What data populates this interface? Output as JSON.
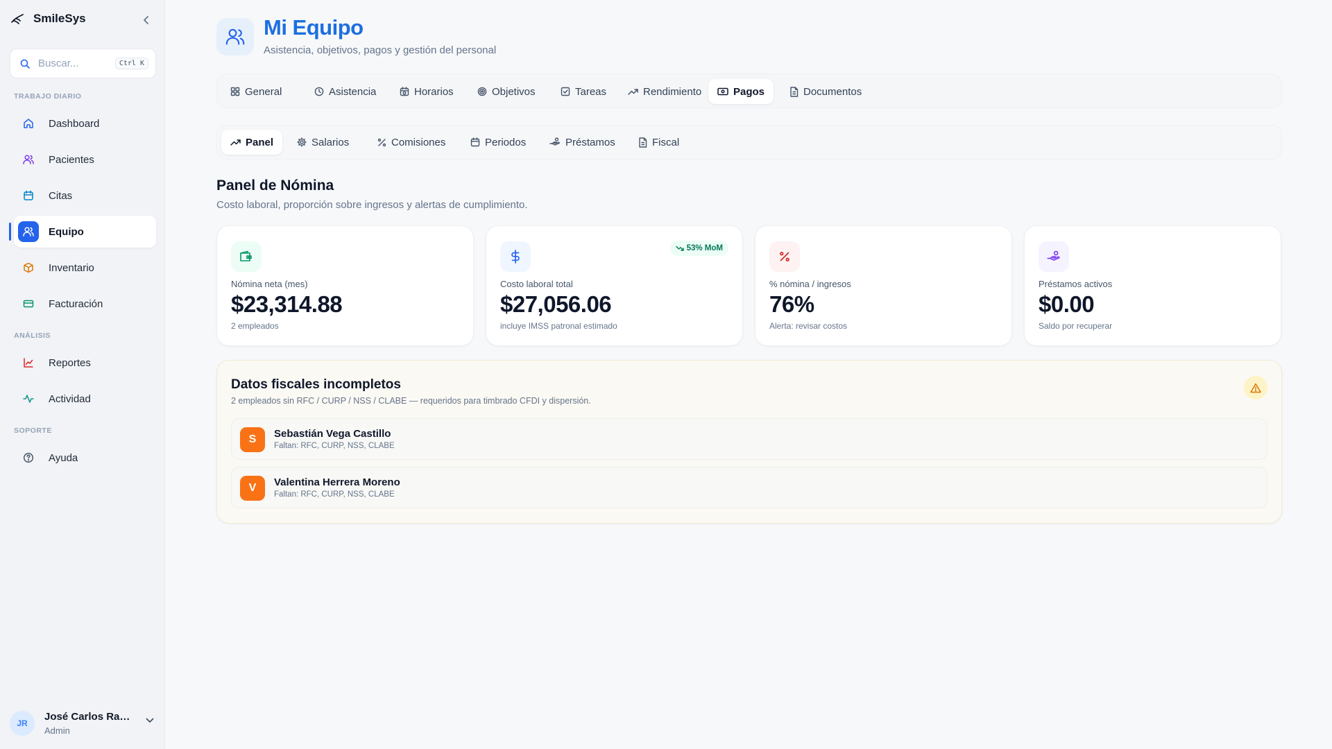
{
  "app": {
    "name": "SmileSys"
  },
  "search": {
    "placeholder": "Buscar...",
    "shortcut": "Ctrl K"
  },
  "sidebar": {
    "sections": [
      {
        "label": "TRABAJO DIARIO"
      },
      {
        "label": "ANÁLISIS"
      },
      {
        "label": "SOPORTE"
      }
    ],
    "items": [
      {
        "label": "Dashboard",
        "icon": "home-icon",
        "color": "#2563eb"
      },
      {
        "label": "Pacientes",
        "icon": "users-icon",
        "color": "#7c3aed"
      },
      {
        "label": "Citas",
        "icon": "calendar-icon",
        "color": "#0284c7"
      },
      {
        "label": "Equipo",
        "icon": "team-icon",
        "color": "#ffffff",
        "active": true
      },
      {
        "label": "Inventario",
        "icon": "box-icon",
        "color": "#d97706"
      },
      {
        "label": "Facturación",
        "icon": "credit-card-icon",
        "color": "#059669"
      },
      {
        "label": "Reportes",
        "icon": "chart-line-icon",
        "color": "#dc2626"
      },
      {
        "label": "Actividad",
        "icon": "activity-icon",
        "color": "#0d9488"
      },
      {
        "label": "Ayuda",
        "icon": "help-circle-icon",
        "color": "#475569"
      }
    ]
  },
  "user": {
    "initials": "JR",
    "name": "José Carlos Ramírez",
    "role": "Admin"
  },
  "header": {
    "title": "Mi Equipo",
    "subtitle": "Asistencia, objetivos, pagos y gestión del personal"
  },
  "tabs": [
    {
      "label": "General",
      "icon": "grid-icon"
    },
    {
      "label": "Asistencia",
      "icon": "clock-icon"
    },
    {
      "label": "Horarios",
      "icon": "calendar-clock-icon"
    },
    {
      "label": "Objetivos",
      "icon": "target-icon"
    },
    {
      "label": "Tareas",
      "icon": "check-square-icon"
    },
    {
      "label": "Rendimiento",
      "icon": "trending-up-icon"
    },
    {
      "label": "Pagos",
      "icon": "banknote-icon",
      "active": true
    },
    {
      "label": "Documentos",
      "icon": "file-icon"
    }
  ],
  "subtabs": [
    {
      "label": "Panel",
      "icon": "trending-up-icon",
      "active": true
    },
    {
      "label": "Salarios",
      "icon": "gear-icon"
    },
    {
      "label": "Comisiones",
      "icon": "percent-icon"
    },
    {
      "label": "Periodos",
      "icon": "calendar-icon"
    },
    {
      "label": "Préstamos",
      "icon": "hand-coins-icon"
    },
    {
      "label": "Fiscal",
      "icon": "file-text-icon"
    }
  ],
  "panel": {
    "title": "Panel de Nómina",
    "description": "Costo laboral, proporción sobre ingresos y alertas de cumplimiento."
  },
  "kpis": [
    {
      "label": "Nómina neta (mes)",
      "value": "$23,314.88",
      "caption": "2 empleados",
      "icon": "wallet-icon",
      "color": "#059669",
      "bg": "#ecfdf5"
    },
    {
      "label": "Costo laboral total",
      "value": "$27,056.06",
      "caption": "incluye IMSS patronal estimado",
      "icon": "dollar-icon",
      "color": "#2563eb",
      "bg": "#eff6ff",
      "badge": "53% MoM"
    },
    {
      "label": "% nómina / ingresos",
      "value": "76%",
      "caption": "Alerta: revisar costos",
      "icon": "percent-icon",
      "color": "#dc2626",
      "bg": "#fef2f2"
    },
    {
      "label": "Préstamos activos",
      "value": "$0.00",
      "caption": "Saldo por recuperar",
      "icon": "hand-coins-icon",
      "color": "#7c3aed",
      "bg": "#f5f3ff"
    }
  ],
  "alert": {
    "title": "Datos fiscales incompletos",
    "description": "2 empleados sin RFC / CURP / NSS / CLABE — requeridos para timbrado CFDI y dispersión.",
    "icon": "warning-icon",
    "employees": [
      {
        "initial": "S",
        "name": "Sebastián Vega Castillo",
        "missing": "Faltan: RFC, CURP, NSS, CLABE"
      },
      {
        "initial": "V",
        "name": "Valentina Herrera Moreno",
        "missing": "Faltan: RFC, CURP, NSS, CLABE"
      }
    ]
  }
}
